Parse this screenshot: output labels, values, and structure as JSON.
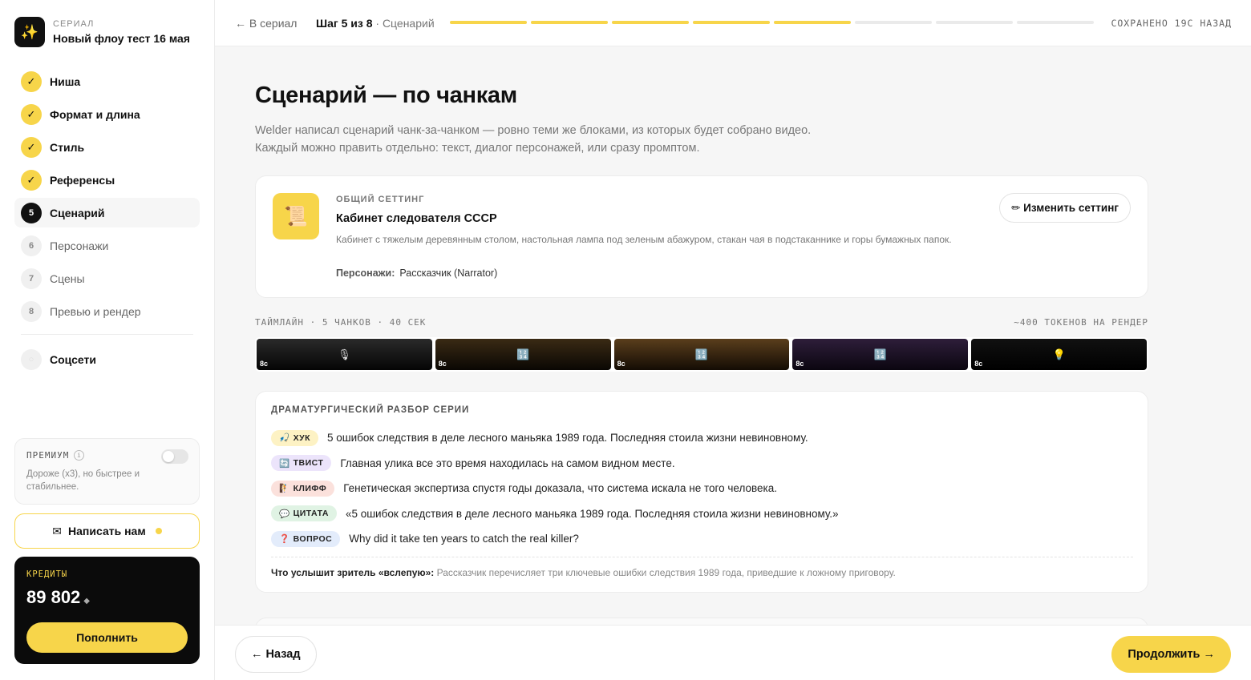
{
  "colors": {
    "accent": "#f7d54a",
    "dark": "#0b0b0b",
    "muted": "#777777"
  },
  "series": {
    "kicker": "Сериал",
    "title": "Новый флоу тест 16 мая",
    "logo_icon": "sparkles-icon",
    "logo_glyph": "✨"
  },
  "nav": {
    "check_glyph": "✓",
    "steps": [
      {
        "label": "Ниша",
        "state": "done"
      },
      {
        "label": "Формат и длина",
        "state": "done"
      },
      {
        "label": "Стиль",
        "state": "done"
      },
      {
        "label": "Референсы",
        "state": "done"
      },
      {
        "label": "Сценарий",
        "state": "active",
        "num": "5"
      },
      {
        "label": "Персонажи",
        "state": "todo",
        "num": "6"
      },
      {
        "label": "Сцены",
        "state": "todo",
        "num": "7"
      },
      {
        "label": "Превью и рендер",
        "state": "todo",
        "num": "8"
      }
    ],
    "extra": {
      "label": "Соцсети",
      "num": "○"
    }
  },
  "premium": {
    "label": "ПРЕМИУМ",
    "info": "i",
    "desc": "Дороже (x3), но быстрее и стабильнее.",
    "enabled": false
  },
  "contact": {
    "icon_glyph": "✉",
    "label": "Написать нам"
  },
  "credits": {
    "label": "КРЕДИТЫ",
    "amount": "89 802",
    "unit_glyph": "◆",
    "topup": "Пополнить"
  },
  "topbar": {
    "back": "← В сериал",
    "step_bold": "Шаг 5 из 8",
    "step_sub": " · Сценарий",
    "progress": {
      "current": 5,
      "total": 8
    },
    "saved": "СОХРАНЕНО 19С НАЗАД"
  },
  "main": {
    "title": "Сценарий — по чанкам",
    "desc_line1": "Welder написал сценарий чанк-за-чанком — ровно теми же блоками, из которых будет собрано видео.",
    "desc_line2": "Каждый можно править отдельно: текст, диалог персонажей, или сразу промптом."
  },
  "setting": {
    "kicker": "ОБЩИЙ СЕТТИНГ",
    "thumb_glyph": "📜",
    "title": "Кабинет следователя СССР",
    "desc": "Кабинет с тяжелым деревянным столом, настольная лампа под зеленым абажуром, стакан чая в подстаканнике и горы бумажных папок.",
    "chars_label": "Персонажи:",
    "chars_value": "Рассказчик (Narrator)",
    "edit_label": "✏ Изменить сеттинг"
  },
  "timeline": {
    "left": "ТАЙМЛАЙН · 5 ЧАНКОВ · 40 СЕК",
    "right": "~400 ТОКЕНОВ НА РЕНДЕР",
    "chunks": [
      {
        "duration": "8с",
        "icon": "🎙",
        "icon_name": "microphone-icon",
        "bg": "linear-gradient(180deg,#2a2a2a 0%,#050505 100%)"
      },
      {
        "duration": "8с",
        "icon": "🔢",
        "icon_name": "numbers-icon",
        "bg": "linear-gradient(180deg,#3a2a14 0%,#0a0703 100%)"
      },
      {
        "duration": "8с",
        "icon": "🔢",
        "icon_name": "numbers-icon",
        "bg": "linear-gradient(180deg,#5a3e1c 0%,#140c04 100%)"
      },
      {
        "duration": "8с",
        "icon": "🔢",
        "icon_name": "numbers-icon",
        "bg": "linear-gradient(180deg,#2e1e3a 0%,#0b0610 100%)"
      },
      {
        "duration": "8с",
        "icon": "💡",
        "icon_name": "lightbulb-icon",
        "bg": "linear-gradient(180deg,#111 0%,#000 100%)"
      }
    ]
  },
  "drama": {
    "kicker": "ДРАМАТУРГИЧЕСКИЙ РАЗБОР СЕРИИ",
    "rows": [
      {
        "tag": "ХУК",
        "glyph": "🎣",
        "cls": "tag-hook",
        "text": "5 ошибок следствия в деле лесного маньяка 1989 года. Последняя стоила жизни невиновному."
      },
      {
        "tag": "ТВИСТ",
        "glyph": "🔄",
        "cls": "tag-twist",
        "text": "Главная улика все это время находилась на самом видном месте."
      },
      {
        "tag": "КЛИФФ",
        "glyph": "🧗",
        "cls": "tag-cliff",
        "text": "Генетическая экспертиза спустя годы доказала, что система искала не того человека."
      },
      {
        "tag": "ЦИТАТА",
        "glyph": "💬",
        "cls": "tag-quote",
        "text": "«5 ошибок следствия в деле лесного маньяка 1989 года. Последняя стоила жизни невиновному.»"
      },
      {
        "tag": "ВОПРОС",
        "glyph": "❓",
        "cls": "tag-question",
        "text": "Why did it take ten years to catch the real killer?"
      }
    ],
    "blind_label": "Что услышит зритель «вслепую»:",
    "blind_text": " Рассказчик перечисляет три ключевые ошибки следствия 1989 года, приведшие к ложному приговору."
  },
  "footer": {
    "back": "← Назад",
    "next": "Продолжить →"
  }
}
